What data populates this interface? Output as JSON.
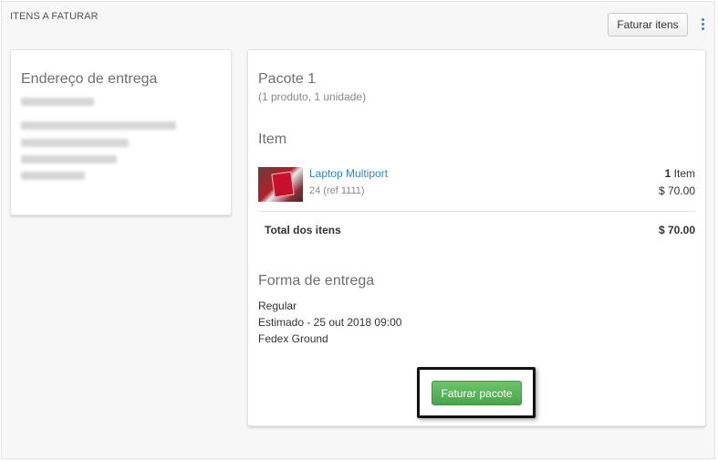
{
  "section": {
    "title": "ITENS A FATURAR"
  },
  "toolbar": {
    "faturar_itens_label": "Faturar itens",
    "more_icon": "kebab-vertical-icon"
  },
  "address": {
    "title": "Endereço de entrega",
    "lines_blurred": true
  },
  "package": {
    "title": "Pacote 1",
    "subtitle": "(1 produto, 1 unidade)",
    "item_section_title": "Item",
    "items": [
      {
        "name": "Laptop Multiport",
        "ref": "24 (ref 1111)",
        "qty_number": "1",
        "qty_unit": "Item",
        "price": "$ 70.00"
      }
    ],
    "total_label": "Total dos itens",
    "total_value": "$ 70.00",
    "shipping_title": "Forma de entrega",
    "shipping_lines": [
      "Regular",
      "Estimado - 25 out 2018 09:00",
      "Fedex Ground"
    ],
    "faturar_pacote_label": "Faturar pacote"
  },
  "colors": {
    "accent_link": "#2e86c9",
    "primary_button": "#4aa54a",
    "highlight_border": "#111111"
  }
}
